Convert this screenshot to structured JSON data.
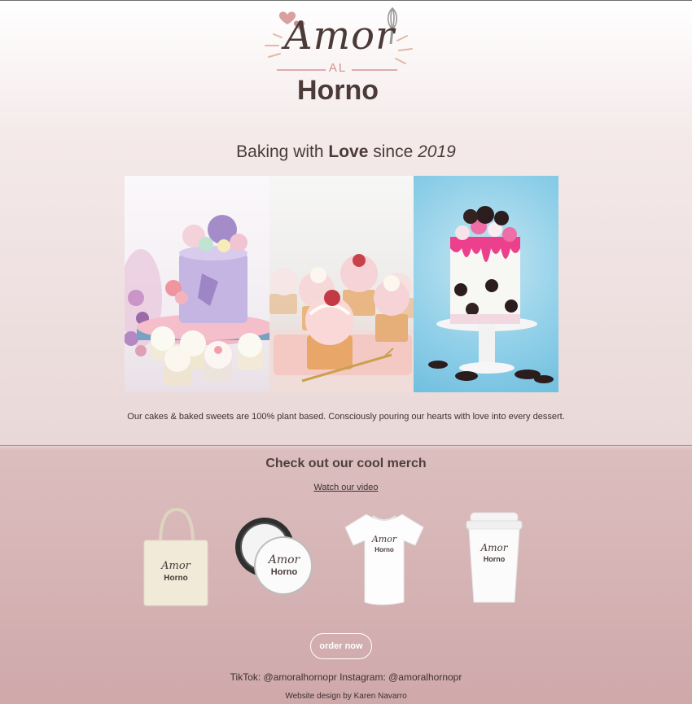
{
  "brand": {
    "logo_line1": "Amor",
    "logo_line2": "AL",
    "logo_line3": "Horno"
  },
  "hero": {
    "tagline_prefix": "Baking with ",
    "tagline_bold": "Love",
    "tagline_middle": " since ",
    "tagline_italic": "2019"
  },
  "gallery": {
    "images": [
      "floral-lavender-cake-photo",
      "cupcakes-photo",
      "oreo-drip-cake-photo"
    ]
  },
  "about": {
    "text": "Our cakes & baked sweets are 100% plant based. Consciously pouring our hearts with love into every dessert."
  },
  "merch": {
    "title": "Check out our cool merch",
    "video_link": "Watch our video",
    "items": [
      "tote-bag",
      "pin-button",
      "t-shirt",
      "coffee-cup"
    ]
  },
  "order": {
    "button_label": "order now"
  },
  "footer": {
    "social": "TikTok: @amoralhornopr Instagram: @amoralhornopr",
    "credit": "Website design by Karen Navarro"
  },
  "colors": {
    "text": "#4a3b3a",
    "accent_pink": "#d49393",
    "background_top": "#f4e9e9",
    "background_bottom": "#cfa8aa"
  }
}
